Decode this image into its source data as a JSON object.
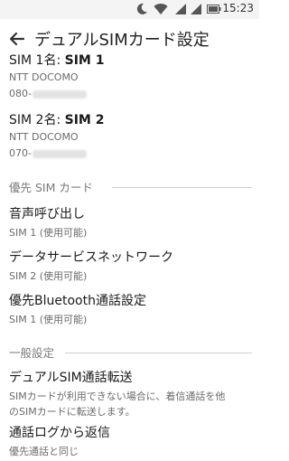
{
  "status_bar": {
    "icons": [
      "moon-icon",
      "wifi-icon",
      "signal-icon",
      "signal-icon",
      "battery-icon"
    ],
    "time": "15:23"
  },
  "app_bar": {
    "title": "デュアルSIMカード設定"
  },
  "sim1": {
    "name_label": "SIM 1名: ",
    "name_value": "SIM 1",
    "carrier": "NTT DOCOMO",
    "number_prefix": "080-"
  },
  "sim2": {
    "name_label": "SIM 2名: ",
    "name_value": "SIM 2",
    "carrier": "NTT DOCOMO",
    "number_prefix": "070-"
  },
  "preferred_section": {
    "header": "優先 SIM カード",
    "items": [
      {
        "title": "音声呼び出し",
        "summary": "SIM 1 (使用可能)"
      },
      {
        "title": "データサービスネットワーク",
        "summary": "SIM 2 (使用可能)"
      },
      {
        "title": "優先Bluetooth通話設定",
        "summary": "SIM 1 (使用可能)"
      }
    ]
  },
  "general_section": {
    "header": "一般設定",
    "items": [
      {
        "title": "デュアルSIM通話転送",
        "summary_line1": "SIMカードが利用できない場合に、着信通話を他",
        "summary_line2": "のSIMカードに転送します。"
      },
      {
        "title": "通話ログから返信",
        "summary": "優先通話と同じ"
      }
    ]
  }
}
